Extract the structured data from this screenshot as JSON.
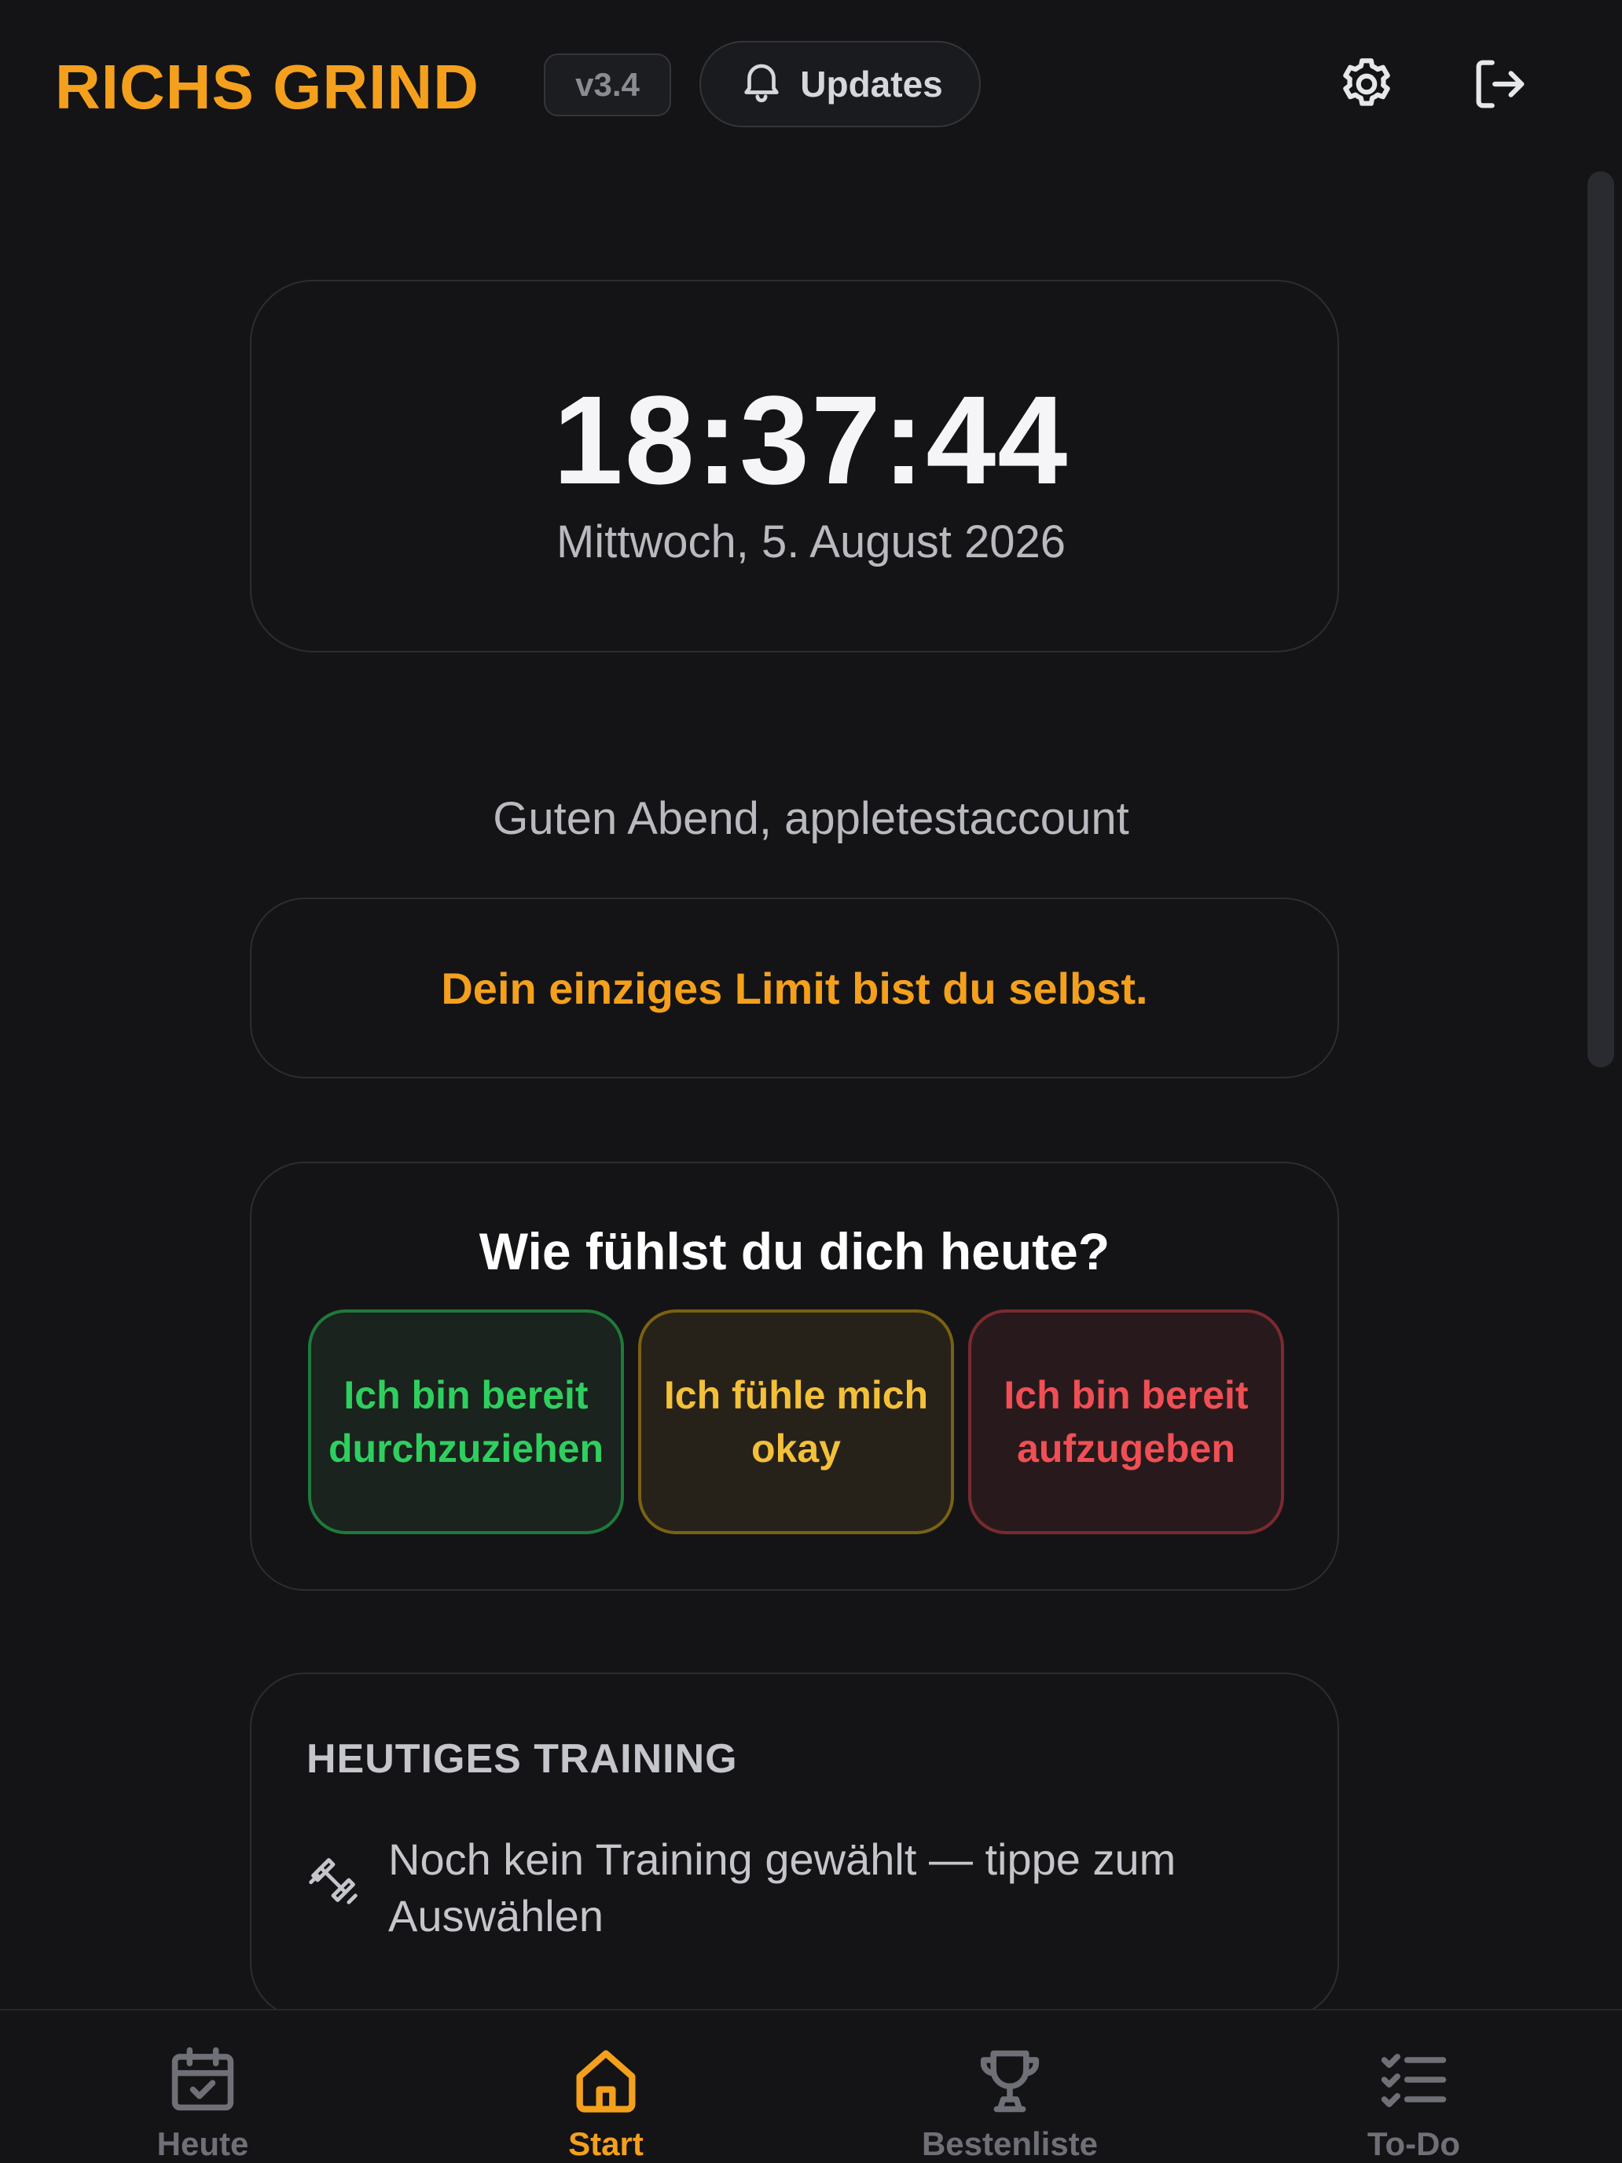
{
  "header": {
    "app_title": "RICHS GRIND",
    "version": "v3.4",
    "updates_label": "Updates",
    "icons": [
      "bell-icon",
      "gear-icon",
      "logout-icon"
    ]
  },
  "clock": {
    "time": "18:37:44",
    "date": "Mittwoch, 5. August 2026"
  },
  "greeting": "Guten Abend, appletestaccount",
  "quote": "Dein einziges Limit bist du selbst.",
  "mood": {
    "title": "Wie fühlst du dich heute?",
    "options": [
      {
        "label": "Ich bin bereit durchzuziehen",
        "color": "#2fcf5f"
      },
      {
        "label": "Ich fühle mich okay",
        "color": "#f3c03a"
      },
      {
        "label": "Ich bin bereit aufzugeben",
        "color": "#ef4f55"
      }
    ]
  },
  "training": {
    "title": "HEUTIGES TRAINING",
    "placeholder": "Noch kein Training gewählt — tippe zum Auswählen",
    "icon": "dumbbell-icon"
  },
  "nav": {
    "items": [
      {
        "label": "Heute",
        "icon": "calendar-check-icon",
        "active": false
      },
      {
        "label": "Start",
        "icon": "home-icon",
        "active": true
      },
      {
        "label": "Bestenliste",
        "icon": "trophy-icon",
        "active": false
      },
      {
        "label": "To-Do",
        "icon": "checklist-icon",
        "active": false
      }
    ]
  },
  "colors": {
    "accent": "#f4a01d",
    "background": "#141416",
    "card_border": "#2c2d33",
    "muted_text": "#b9bac0",
    "nav_inactive": "#6f7077"
  }
}
